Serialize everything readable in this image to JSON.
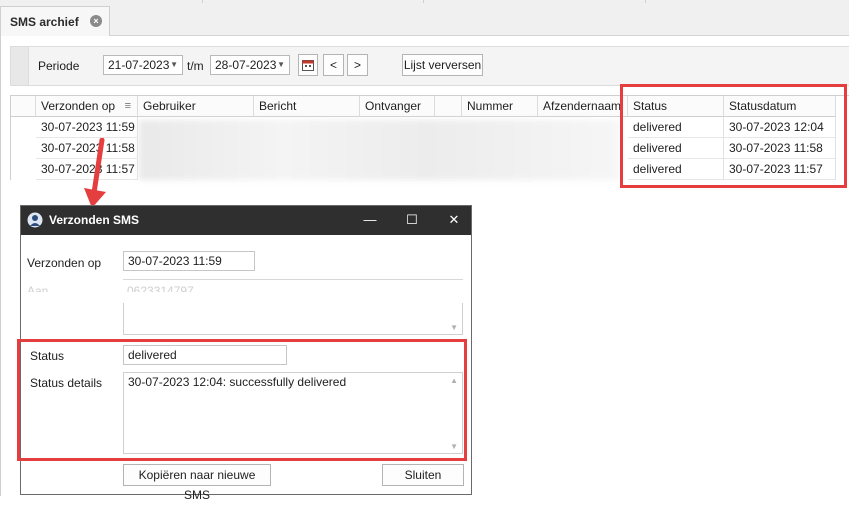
{
  "tab": {
    "title": "SMS archief",
    "close_glyph": "×"
  },
  "toolbar": {
    "periode_label": "Periode",
    "date_from": "21-07-2023",
    "tm_label": "t/m",
    "date_to": "28-07-2023",
    "prev_glyph": "<",
    "next_glyph": ">",
    "refresh_label": "Lijst verversen"
  },
  "grid": {
    "columns": [
      "Verzonden op",
      "Gebruiker",
      "Bericht",
      "Ontvanger",
      "Nummer",
      "Afzendernaam",
      "Status",
      "Statusdatum"
    ],
    "rows": [
      {
        "verzonden": "30-07-2023 11:59",
        "status": "delivered",
        "statusdatum": "30-07-2023 12:04"
      },
      {
        "verzonden": "30-07-2023 11:58",
        "status": "delivered",
        "statusdatum": "30-07-2023 11:58"
      },
      {
        "verzonden": "30-07-2023 11:57",
        "status": "delivered",
        "statusdatum": "30-07-2023 11:57"
      }
    ]
  },
  "dialog": {
    "title": "Verzonden SMS",
    "verzonden_label": "Verzonden op",
    "verzonden_value": "30-07-2023  11:59",
    "aan_label": "Aan",
    "aan_value": "0623314797",
    "status_label": "Status",
    "status_value": "delivered",
    "details_label": "Status details",
    "details_value": "30-07-2023 12:04: successfully delivered",
    "copy_button": "Kopiëren naar nieuwe SMS",
    "close_button": "Sluiten",
    "minimize_glyph": "—",
    "maximize_glyph": "☐",
    "close_glyph": "✕"
  },
  "colors": {
    "highlight": "#e53e3e",
    "titlebar": "#2f2f2f"
  }
}
